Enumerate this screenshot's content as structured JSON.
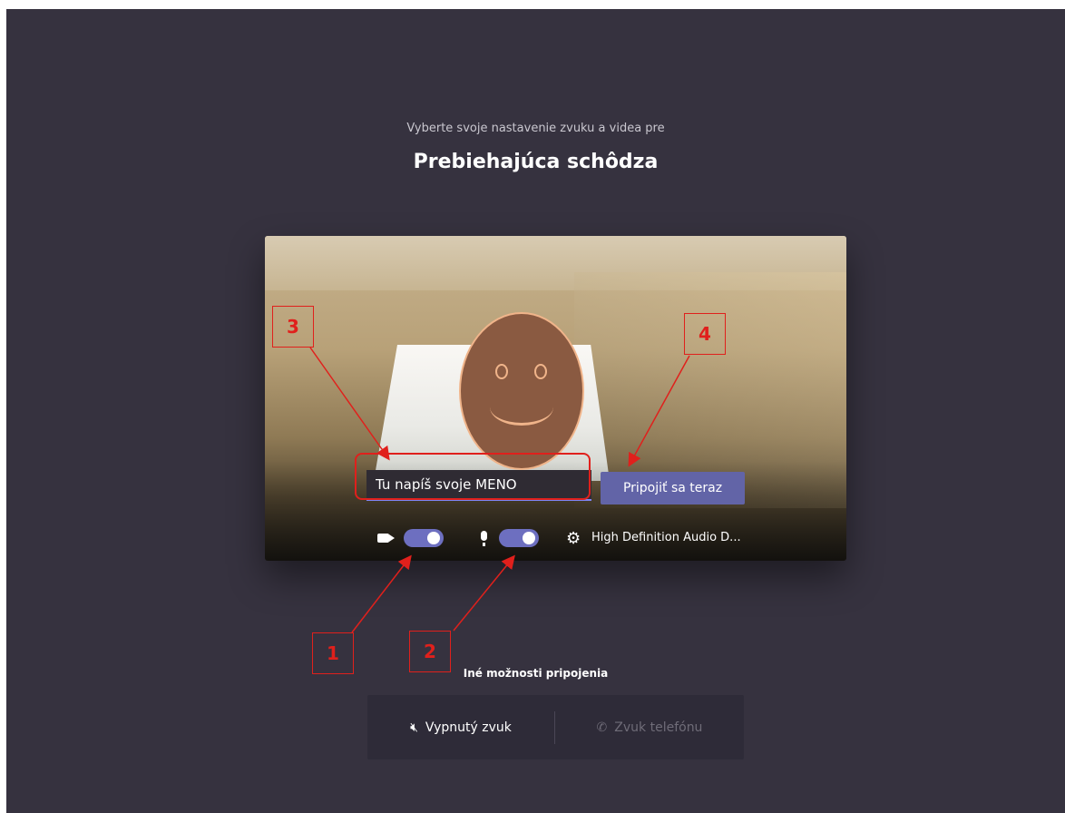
{
  "header": {
    "subtitle": "Vyberte svoje nastavenie zvuku a videa pre",
    "title": "Prebiehajúca schôdza"
  },
  "preview": {
    "name_input_value": "Tu napíš svoje MENO",
    "join_button_label": "Pripojiť sa teraz",
    "camera_on": true,
    "mic_on": true,
    "audio_device_label": "High Definition Audio D..."
  },
  "annotations": {
    "labels": [
      "1",
      "2",
      "3",
      "4"
    ],
    "color": "#e0201c"
  },
  "other_options": {
    "title": "Iné možnosti pripojenia",
    "mute_label": "Vypnutý zvuk",
    "phone_label": "Zvuk telefónu"
  },
  "colors": {
    "background": "#36323f",
    "accent": "#6264a7",
    "toggle_on": "#6d6fc0"
  }
}
